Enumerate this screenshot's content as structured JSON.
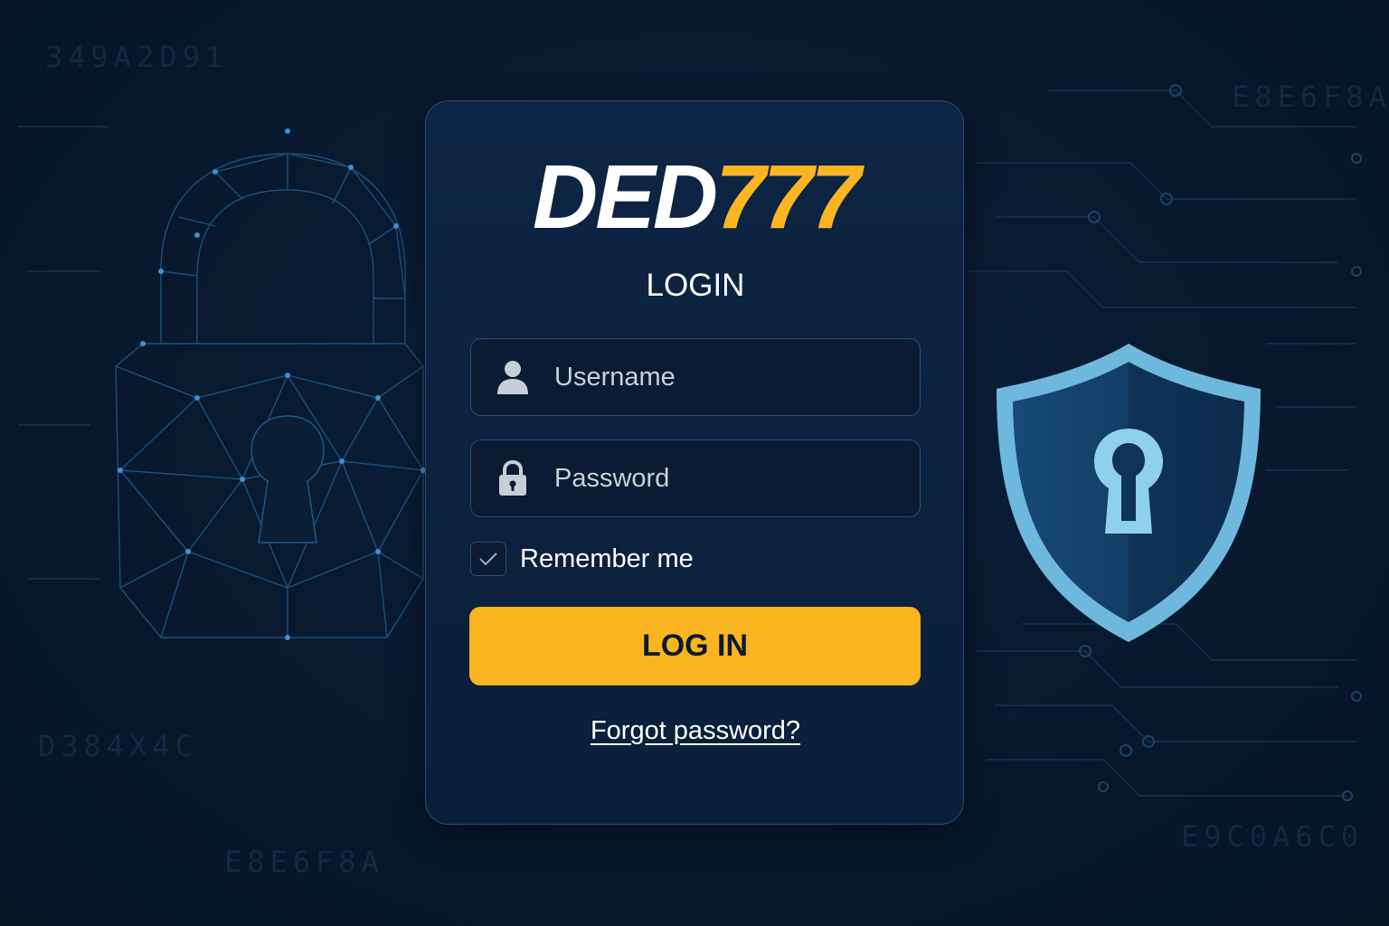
{
  "colors": {
    "background": "#081a31",
    "card": "#0c2240",
    "accent": "#fbb520",
    "field_border": "#2d4c74",
    "shield": "#7cc3e4"
  },
  "background_codes": [
    "349A2D91",
    "E8E6F8A",
    "D384X4C",
    "E8E6F8A",
    "E9C0A6C0"
  ],
  "logo": {
    "part1": "DED",
    "part2": "777"
  },
  "form": {
    "title": "LOGIN",
    "username": {
      "placeholder": "Username",
      "value": "",
      "icon": "user-icon"
    },
    "password": {
      "placeholder": "Password",
      "value": "",
      "icon": "lock-icon"
    },
    "remember": {
      "label": "Remember me",
      "checked": true
    },
    "submit_label": "LOG IN",
    "forgot_label": "Forgot password?"
  },
  "decor": {
    "left_icon": "padlock-icon",
    "right_icon": "shield-keyhole-icon"
  }
}
